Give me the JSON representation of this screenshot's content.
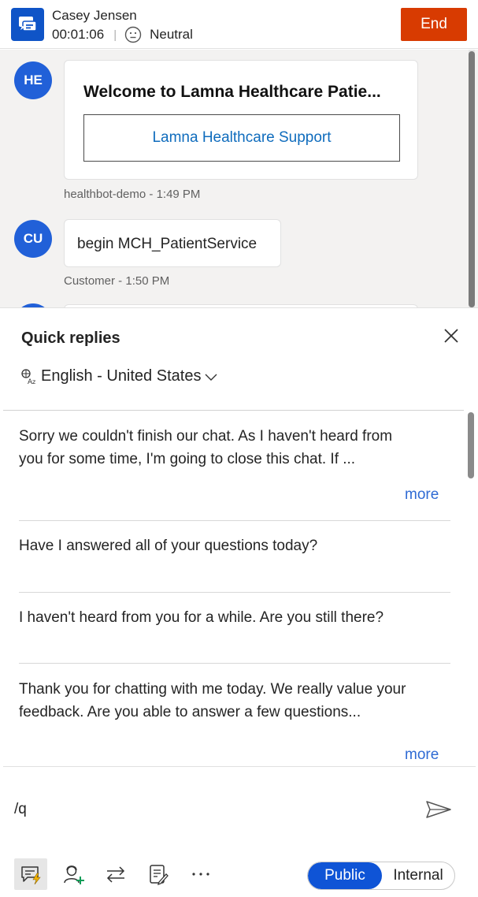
{
  "header": {
    "customer_name": "Casey Jensen",
    "timer": "00:01:06",
    "sentiment": "Neutral",
    "end_label": "End",
    "end_color": "#d83b01"
  },
  "conversation": {
    "messages": [
      {
        "avatar": "HE",
        "card_title": "Welcome to Lamna Healthcare Patie...",
        "card_button": "Lamna Healthcare Support",
        "meta": "healthbot-demo - 1:49 PM"
      },
      {
        "avatar": "CU",
        "text": "begin MCH_PatientService",
        "meta": "Customer - 1:50 PM"
      }
    ]
  },
  "quick_replies": {
    "title": "Quick replies",
    "language": "English - United States",
    "items": [
      {
        "line1": "Sorry we couldn't finish our chat. As I haven't heard from",
        "line2": "you for some time, I'm going to close this chat. If ...",
        "more": "more"
      },
      {
        "line1": "Have I answered all of your questions today?"
      },
      {
        "line1": "I haven't heard from you for a while. Are you still there?"
      },
      {
        "line1": "Thank you for chatting with me today. We really value your",
        "line2": "feedback. Are you able to answer a few questions...",
        "more": "more"
      }
    ]
  },
  "compose": {
    "value": "/q"
  },
  "visibility": {
    "public_label": "Public",
    "internal_label": "Internal",
    "selected": "Public"
  },
  "icons": {
    "app": "chat-app-icon",
    "sentiment": "neutral-face-icon",
    "close": "close-icon",
    "language": "translate-icon",
    "send": "send-icon",
    "toolbar": [
      "quick-replies-icon",
      "consult-agent-icon",
      "transfer-icon",
      "notes-icon",
      "more-icon"
    ]
  }
}
